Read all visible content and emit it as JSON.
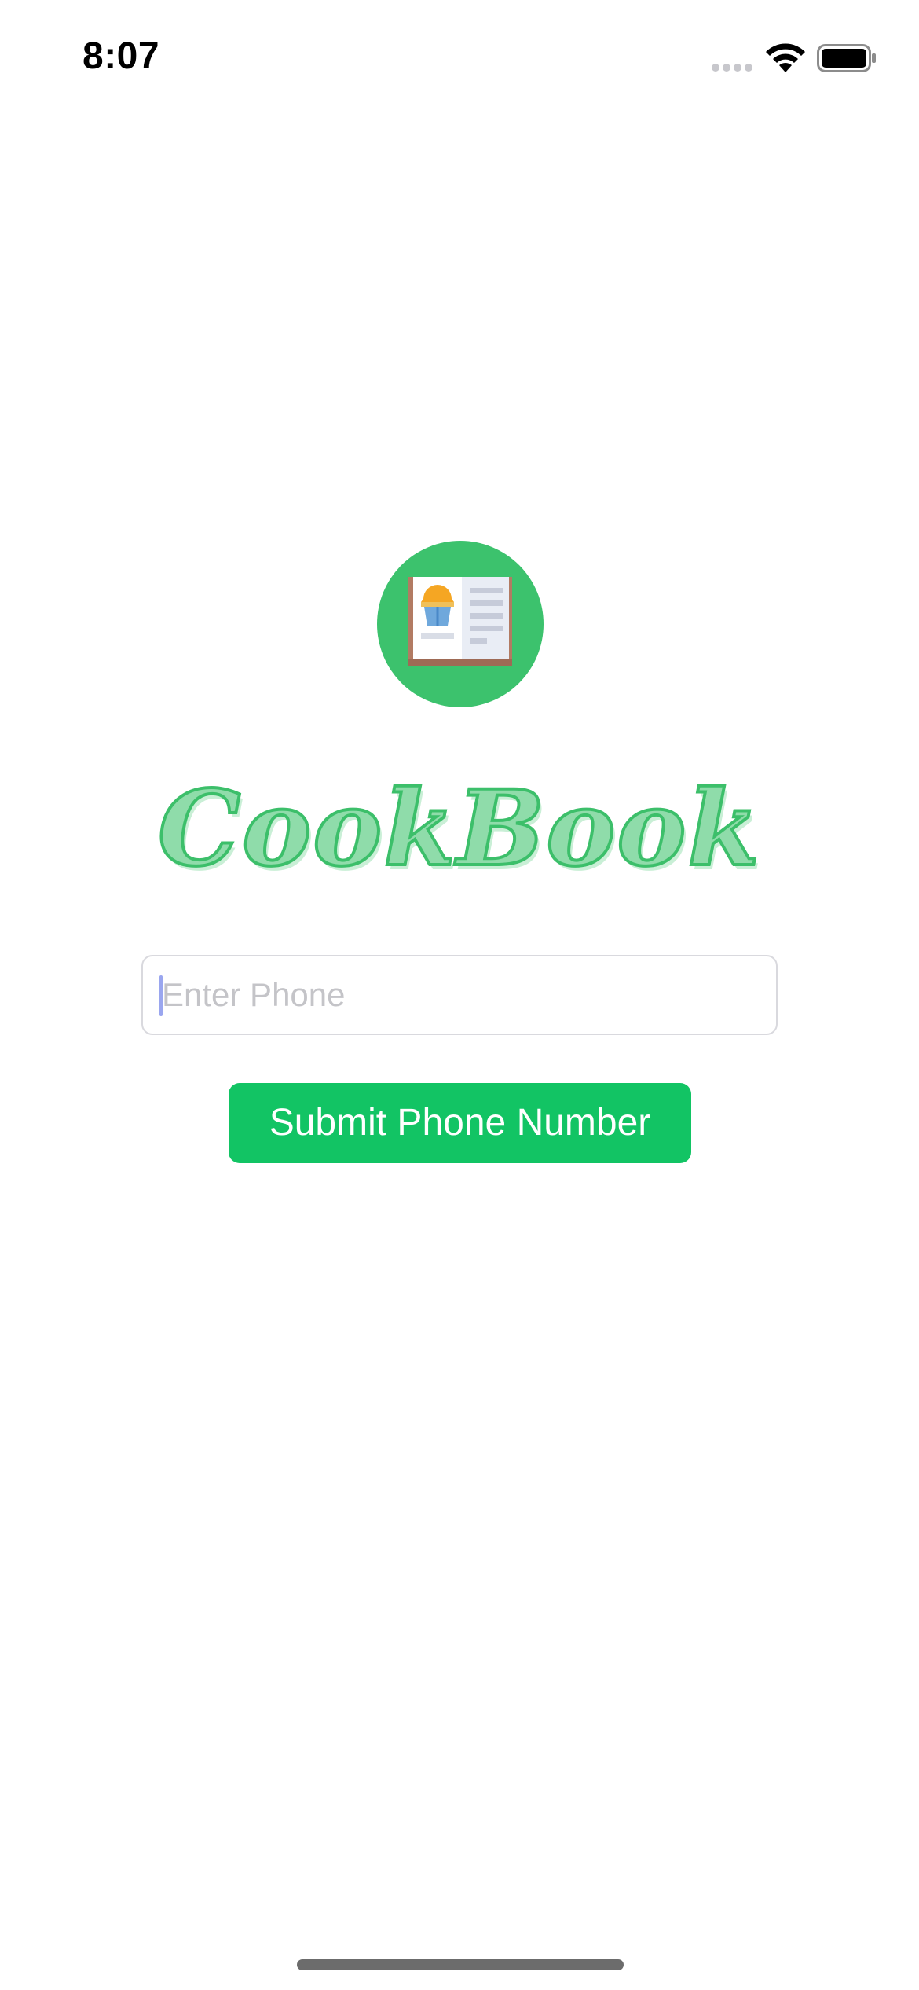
{
  "status_bar": {
    "time": "8:07",
    "icons": [
      "signal-icon",
      "wifi-icon",
      "battery-icon"
    ]
  },
  "logo": {
    "icon": "cookbook-icon",
    "background_color": "#3cc26d"
  },
  "app": {
    "title": "CookBook",
    "title_fill_color": "#8fdcaa",
    "title_outline_color": "#3cbf6a"
  },
  "form": {
    "phone_placeholder": "Enter Phone",
    "phone_value": "",
    "submit_label": "Submit Phone Number",
    "submit_color": "#12c464"
  }
}
